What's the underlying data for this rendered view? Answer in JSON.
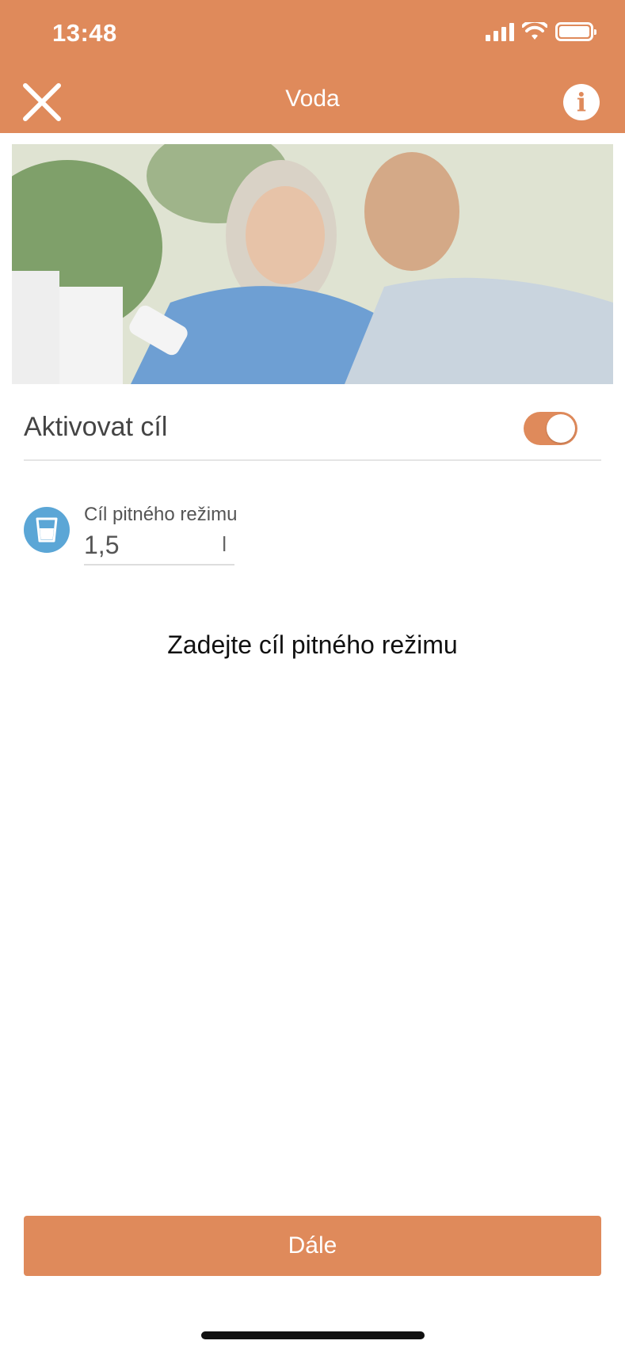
{
  "status_bar": {
    "time": "13:48"
  },
  "nav": {
    "title": "Voda"
  },
  "toggle": {
    "label": "Aktivovat cíl",
    "on": true
  },
  "goal": {
    "label": "Cíl pitného režimu",
    "value": "1,5",
    "unit": "l"
  },
  "hint": "Zadejte cíl pitného režimu",
  "footer": {
    "next_label": "Dále"
  },
  "colors": {
    "accent": "#df8a5b",
    "icon_bg": "#5ba6d6"
  },
  "icons": {
    "close": "close-icon",
    "info": "info-icon",
    "glass": "glass-icon"
  }
}
